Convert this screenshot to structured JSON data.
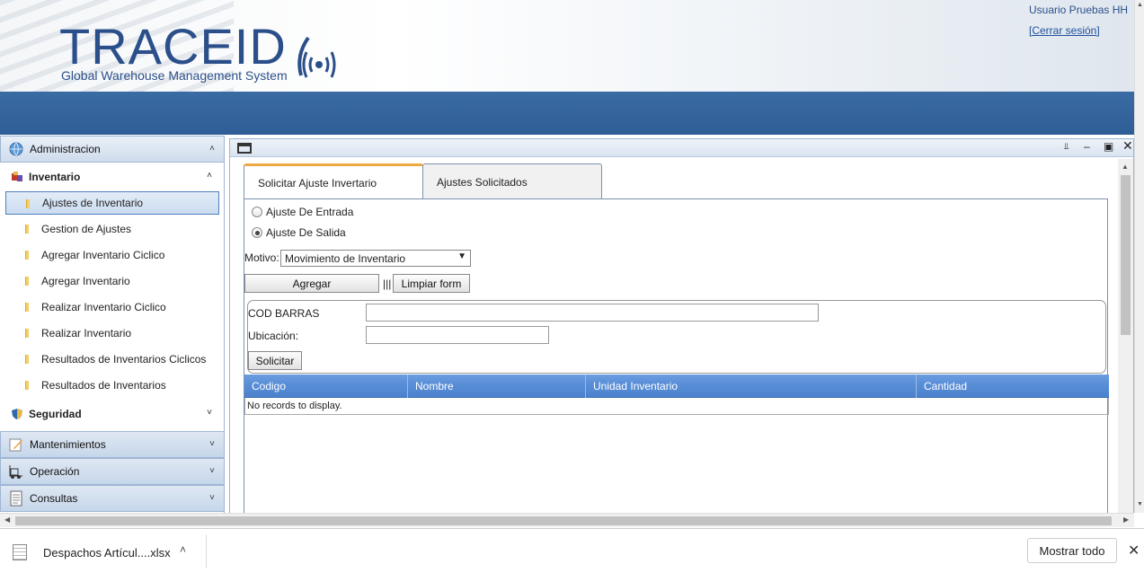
{
  "header": {
    "logo_title": "TRACEID",
    "logo_subtitle": "Global Warehouse Management System",
    "user_name": "Usuario Pruebas HH",
    "logout": "[Cerrar sesión]"
  },
  "sidebar": {
    "administracion": "Administracion",
    "inventario": "Inventario",
    "inventario_items": [
      "Ajustes de Inventario",
      "Gestion de Ajustes",
      "Agregar Inventario Ciclico",
      "Agregar Inventario",
      "Realizar Inventario Ciclico",
      "Realizar Inventario",
      "Resultados de Inventarios Ciclicos",
      "Resultados de Inventarios"
    ],
    "seguridad": "Seguridad",
    "mantenimientos": "Mantenimientos",
    "operacion": "Operación",
    "consultas": "Consultas"
  },
  "window": {
    "tabs": [
      "Solicitar Ajuste Invertario",
      "Ajustes Solicitados"
    ],
    "radio_entrada": "Ajuste De Entrada",
    "radio_salida": "Ajuste De Salida",
    "motivo_label": "Motivo:",
    "motivo_value": "Movimiento de Inventario",
    "agregar": "Agregar",
    "separator": "|||",
    "limpiar": "Limpiar form",
    "cod_barras_label": "COD BARRAS",
    "ubicacion_label": "Ubicación:",
    "solicitar": "Solicitar",
    "grid_columns": [
      "Codigo",
      "Nombre",
      "Unidad Inventario",
      "Cantidad"
    ],
    "grid_empty": "No records to display."
  },
  "downloads": {
    "file_name": "Despachos Artícul....xlsx",
    "show_all": "Mostrar todo"
  },
  "colors": {
    "brand": "#2b4f8a",
    "header_bar": "#2f5e96",
    "grid_header": "#5a8fd8",
    "tab_accent": "#f0a840"
  }
}
